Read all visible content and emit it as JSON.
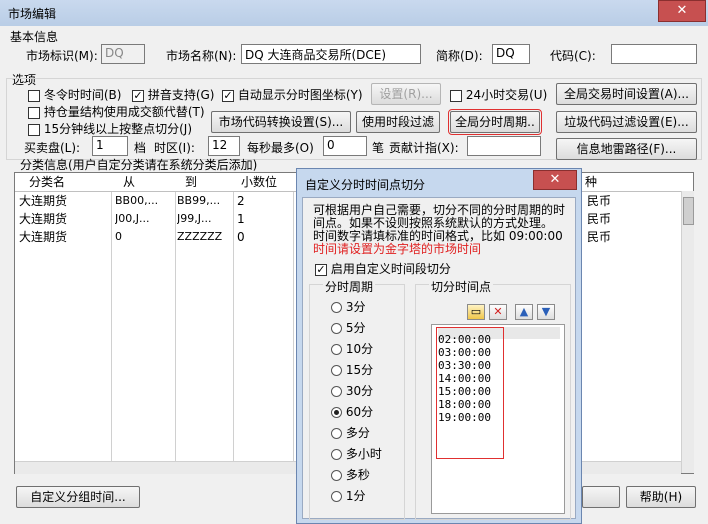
{
  "window": {
    "title": "市场编辑",
    "close": "✕"
  },
  "basic": {
    "group_label": "基本信息",
    "market_id_label": "市场标识(M):",
    "market_id_value": "DQ",
    "market_name_label": "市场名称(N):",
    "market_name_value": "DQ 大连商品交易所(DCE)",
    "short_label": "简称(D):",
    "short_value": "DQ",
    "code_label": "代码(C):",
    "code_value": ""
  },
  "options": {
    "group_label": "选项",
    "winter_time": {
      "label": "冬令时时间(B)",
      "checked": false
    },
    "pinyin": {
      "label": "拼音支持(G)",
      "checked": true
    },
    "auto_show": {
      "label": "自动显示分时图坐标(Y)",
      "checked": true
    },
    "settings_btn": "设置(R)...",
    "h24": {
      "label": "24小时交易(U)",
      "checked": false
    },
    "global_trade_btn": "全局交易时间设置(A)...",
    "holding": {
      "label": "持仓量结构使用成交额代替(T)",
      "checked": false
    },
    "min15": {
      "label": "15分钟线以上按整点切分(J)",
      "checked": false
    },
    "code_convert_btn": "市场代码转换设置(S)...",
    "use_period_filter_btn": "使用时段过滤",
    "global_period_btn": "全局分时周期..",
    "junk_code_btn": "垃圾代码过滤设置(E)...",
    "bid_label": "买卖盘(L):",
    "bid_value": "1",
    "bid_unit": "档",
    "tz_label": "时区(I):",
    "tz_value": "12",
    "per_sec_label": "每秒最多(O)",
    "per_sec_value": "0",
    "per_sec_unit": "笔",
    "contrib_label": "贡献计指(X):",
    "contrib_value": "",
    "info_path_btn": "信息地雷路径(F)..."
  },
  "category": {
    "caption": "分类信息(用户自定分类请在系统分类后添加)",
    "columns": [
      "分类名",
      "从",
      "到",
      "小数位"
    ],
    "right_col": "种",
    "rows": [
      {
        "name": "大连期货",
        "from": "BB00,...",
        "to": "BB99,...",
        "dec": "2",
        "cur": "民币"
      },
      {
        "name": "大连期货",
        "from": "J00,J...",
        "to": "J99,J...",
        "dec": "1",
        "cur": "民币"
      },
      {
        "name": "大连期货",
        "from": "0",
        "to": "ZZZZZZ",
        "dec": "0",
        "cur": "民币"
      }
    ]
  },
  "bottom": {
    "custom_group_btn": "自定义分组时间...",
    "help_btn": "帮助(H)"
  },
  "dialog": {
    "title": "自定义分时时间点切分",
    "close": "✕",
    "desc_line1": "可根据用户自己需要，切分不同的分时周期的时",
    "desc_line2": "间点。如果不设则按照系统默认的方式处理。",
    "desc_line3": "时间数字请填标准的时间格式，比如 09:00:00",
    "warn": "时间请设置为金字塔的市场时间",
    "enable": {
      "label": "启用自定义时间段切分",
      "checked": true
    },
    "period_group": "分时周期",
    "periods": [
      {
        "label": "3分",
        "selected": false
      },
      {
        "label": "5分",
        "selected": false
      },
      {
        "label": "10分",
        "selected": false
      },
      {
        "label": "15分",
        "selected": false
      },
      {
        "label": "30分",
        "selected": false
      },
      {
        "label": "60分",
        "selected": true
      },
      {
        "label": "多分",
        "selected": false
      },
      {
        "label": "多小时",
        "selected": false
      },
      {
        "label": "多秒",
        "selected": false
      },
      {
        "label": "1分",
        "selected": false
      }
    ],
    "points_group": "切分时间点",
    "points": [
      "02:00:00",
      "03:00:00",
      "03:30:00",
      "14:00:00",
      "15:00:00",
      "18:00:00",
      "19:00:00"
    ]
  },
  "colors": {
    "highlight": "#e03030",
    "warn_text": "#e02020",
    "dialog_frame": "#c6d8ee"
  }
}
